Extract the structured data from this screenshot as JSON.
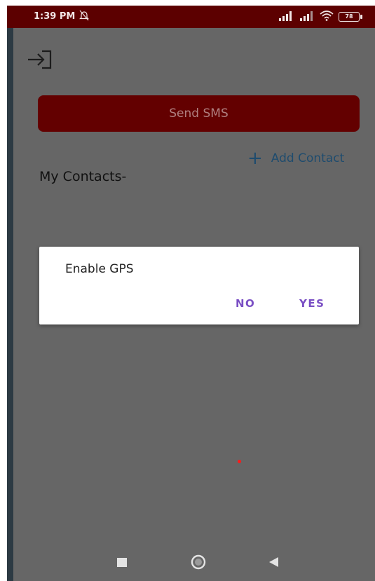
{
  "status_bar": {
    "time": "1:39 PM",
    "dnd_icon": "bell-off-icon",
    "battery_level": "78"
  },
  "header": {
    "logout_icon": "logout-icon"
  },
  "main": {
    "send_sms_label": "Send SMS",
    "add_contact_label": "Add Contact",
    "my_contacts_title": "My Contacts-"
  },
  "dialog": {
    "message": "Enable GPS",
    "no_label": "NO",
    "yes_label": "YES"
  },
  "colors": {
    "status_bar": "#5c0000",
    "primary_button": "#630000",
    "dialog_action": "#7a4fc4",
    "link": "#1f4c6e",
    "scrim_background": "#666666"
  }
}
